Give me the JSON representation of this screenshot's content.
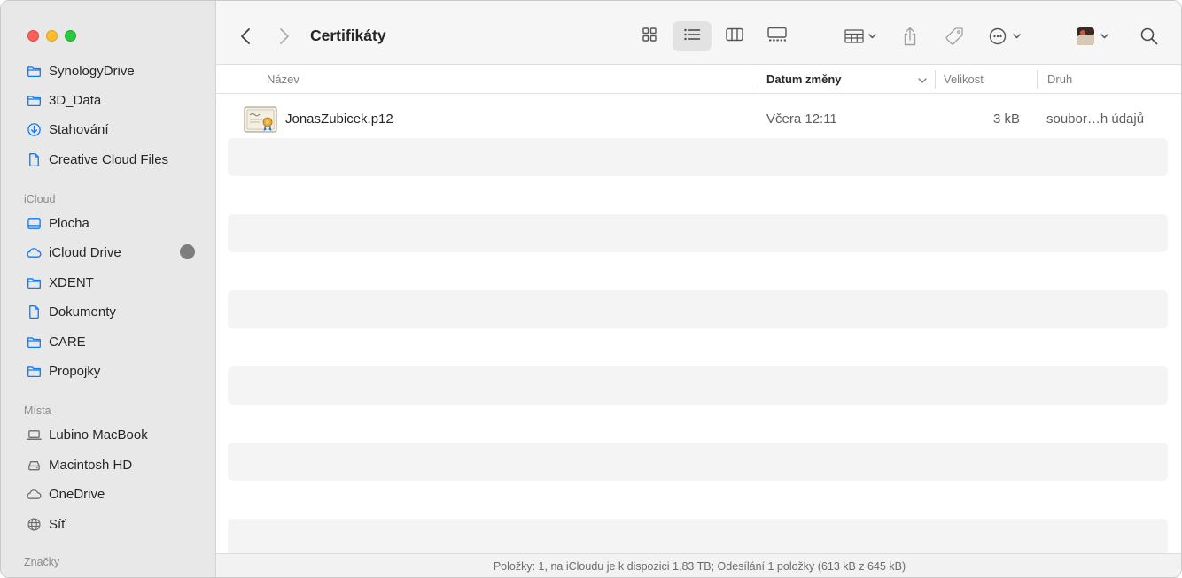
{
  "window": {
    "title": "Certifikáty"
  },
  "sidebar": {
    "favorites": [
      {
        "label": "SynologyDrive",
        "icon": "folder-icon"
      },
      {
        "label": "3D_Data",
        "icon": "folder-icon"
      },
      {
        "label": "Stahování",
        "icon": "download-icon"
      },
      {
        "label": "Creative Cloud Files",
        "icon": "document-icon"
      }
    ],
    "icloud_heading": "iCloud",
    "icloud": [
      {
        "label": "Plocha",
        "icon": "desktop-icon"
      },
      {
        "label": "iCloud Drive",
        "icon": "cloud-icon"
      },
      {
        "label": "XDENT",
        "icon": "folder-icon"
      },
      {
        "label": "Dokumenty",
        "icon": "document-icon"
      },
      {
        "label": "CARE",
        "icon": "folder-icon"
      },
      {
        "label": "Propojky",
        "icon": "folder-icon"
      }
    ],
    "places_heading": "Místa",
    "places": [
      {
        "label": "Lubino MacBook",
        "icon": "laptop-icon"
      },
      {
        "label": "Macintosh HD",
        "icon": "hard-drive-icon"
      },
      {
        "label": "OneDrive",
        "icon": "cloud-icon"
      },
      {
        "label": "Síť",
        "icon": "globe-icon"
      }
    ],
    "tags_heading": "Značky"
  },
  "columns": {
    "name": "Název",
    "date": "Datum změny",
    "size": "Velikost",
    "kind": "Druh"
  },
  "files": [
    {
      "name": "JonasZubicek.p12",
      "date": "Včera 12:11",
      "size": "3 kB",
      "kind": "soubor…h údajů",
      "icon": "certificate-file-icon"
    }
  ],
  "status": {
    "text": "Položky: 1, na iCloudu je k dispozici 1,83 TB; Odesílání 1 položky (613 kB z 645 kB)"
  },
  "colors": {
    "sidebar_bg": "#e8e8e8",
    "toolbar_bg": "#f6f6f6",
    "stripe": "#f4f4f4",
    "accent": "#0a7aff"
  }
}
